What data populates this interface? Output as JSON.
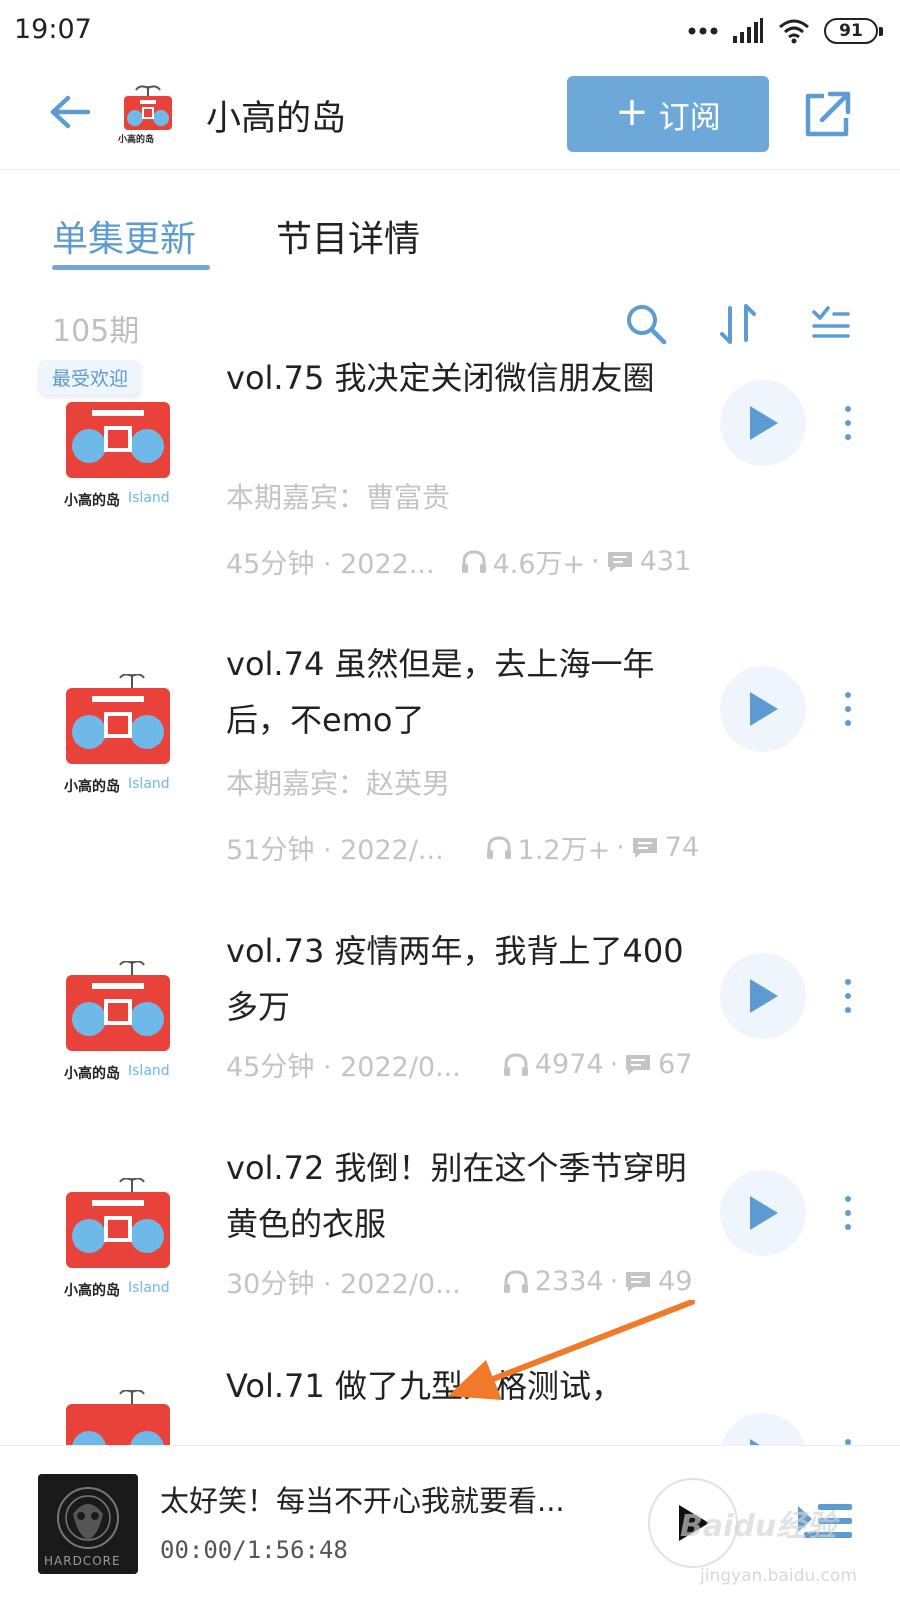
{
  "status_bar": {
    "time": "19:07",
    "battery": "91",
    "icons": [
      "dots-icon",
      "signal-icon",
      "wifi-icon",
      "battery-icon"
    ]
  },
  "header": {
    "title": "小高的岛",
    "logo_text": "小高的岛",
    "subscribe_label": "订阅"
  },
  "tabs": [
    {
      "label": "单集更新",
      "active": true
    },
    {
      "label": "节目详情",
      "active": false
    }
  ],
  "toolbar": {
    "episode_count": "105期",
    "icons": [
      "search-icon",
      "sort-icon",
      "filter-list-icon"
    ]
  },
  "episodes": [
    {
      "badge": "最受欢迎",
      "title": "vol.75 我决定关闭微信朋友圈",
      "guest": "本期嘉宾：曹富贵",
      "duration_date": "45分钟 · 2022...",
      "plays": "4.6万+",
      "comments": "431"
    },
    {
      "badge": "",
      "title": "vol.74 虽然但是，去上海一年后，不emo了",
      "guest": "本期嘉宾：赵英男",
      "duration_date": "51分钟 · 2022/...",
      "plays": "1.2万+",
      "comments": "74"
    },
    {
      "badge": "",
      "title": "vol.73 疫情两年，我背上了400多万",
      "guest": "",
      "duration_date": "45分钟 · 2022/0...",
      "plays": "4974",
      "comments": "67"
    },
    {
      "badge": "",
      "title": "vol.72 我倒！别在这个季节穿明黄色的衣服",
      "guest": "",
      "duration_date": "30分钟 · 2022/0...",
      "plays": "2334",
      "comments": "49"
    },
    {
      "badge": "",
      "title": "Vol.71 做了九型人格测试，",
      "guest": "",
      "duration_date": "",
      "plays": "",
      "comments": ""
    }
  ],
  "cover_logo_text": "小高的岛",
  "cover_logo_island": "Island",
  "mini_player": {
    "title": "太好笑！每当不开心我就要看...",
    "time": "00:00/1:56:48",
    "cover_text": "HARDCORE"
  },
  "watermark": {
    "main": "Baidu经验",
    "sub": "jingyan.baidu.com"
  },
  "colors": {
    "accent": "#6ea8d8",
    "accent_text": "#5d9bd0",
    "muted": "#c4c4c4",
    "arrow": "#f07a2a",
    "logo_red": "#e8423a",
    "logo_blue": "#6fb9e8"
  }
}
